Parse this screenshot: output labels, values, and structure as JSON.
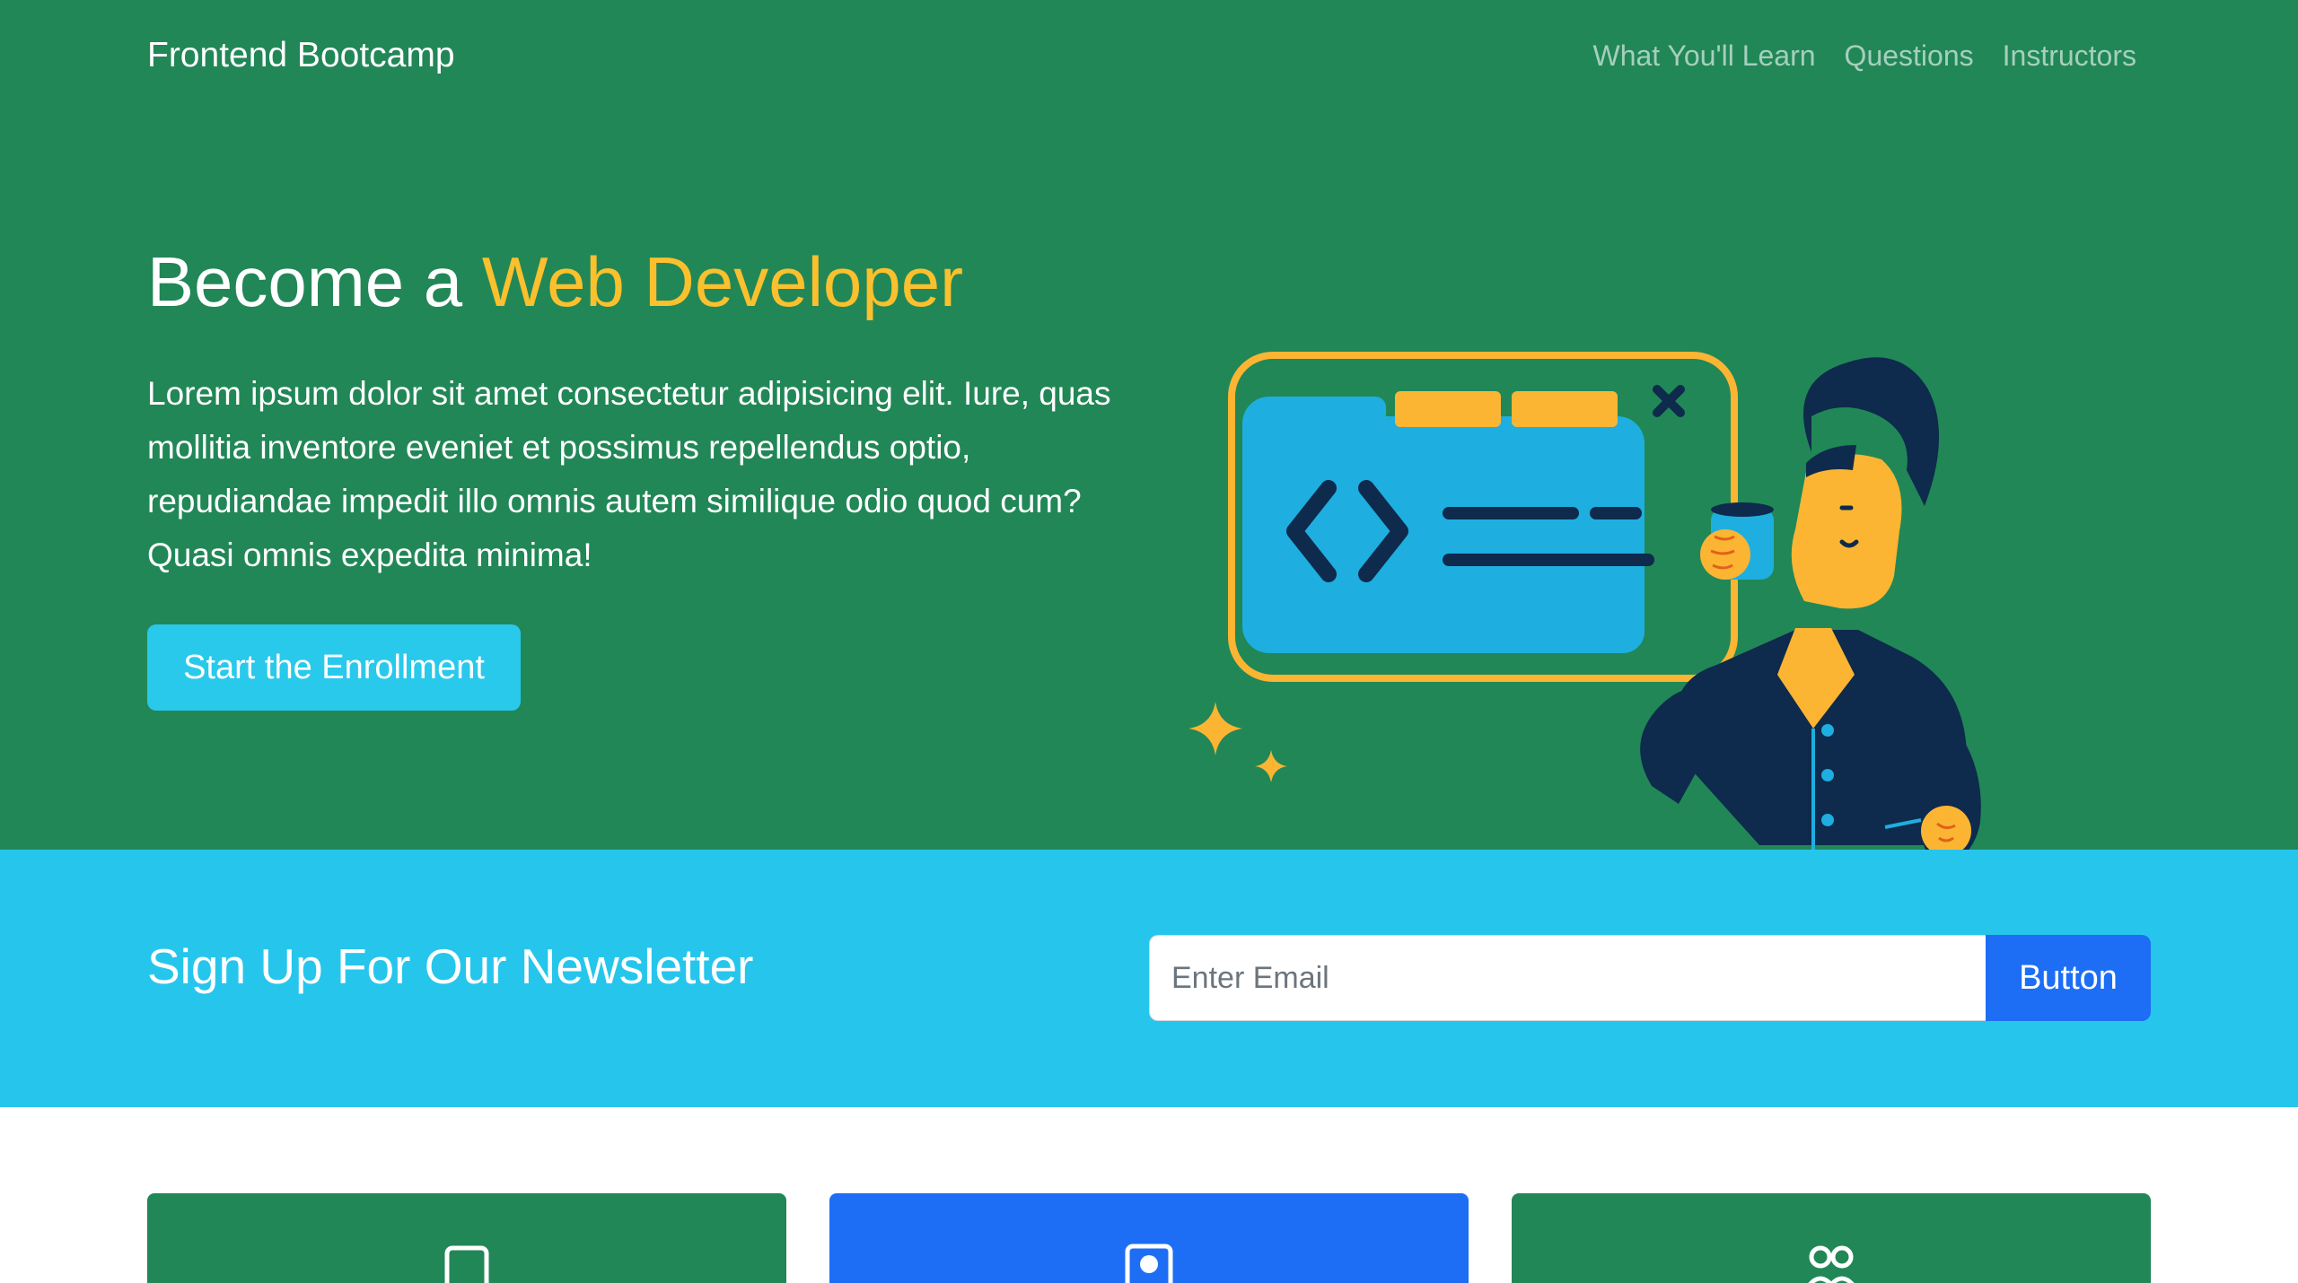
{
  "navbar": {
    "brand": "Frontend Bootcamp",
    "links": [
      "What You'll Learn",
      "Questions",
      "Instructors"
    ]
  },
  "hero": {
    "title_prefix": "Become a ",
    "title_accent": "Web Developer",
    "text": "Lorem ipsum dolor sit amet consectetur adipisicing elit. Iure, quas mollitia inventore eveniet et possimus repellendus optio, repudiandae impedit illo omnis autem similique odio quod cum? Quasi omnis expedita minima!",
    "cta_label": "Start the Enrollment"
  },
  "newsletter": {
    "heading": "Sign Up For Our Newsletter",
    "email_placeholder": "Enter Email",
    "button_label": "Button"
  },
  "cards": [
    {
      "icon": "tablet-icon",
      "color": "#218757"
    },
    {
      "icon": "person-badge-icon",
      "color": "#1d6ef5"
    },
    {
      "icon": "people-icon",
      "color": "#218757"
    }
  ],
  "colors": {
    "hero_green": "#218757",
    "accent_yellow": "#fbc02d",
    "cyan": "#26c6ec",
    "primary_blue": "#1d6ef5"
  }
}
